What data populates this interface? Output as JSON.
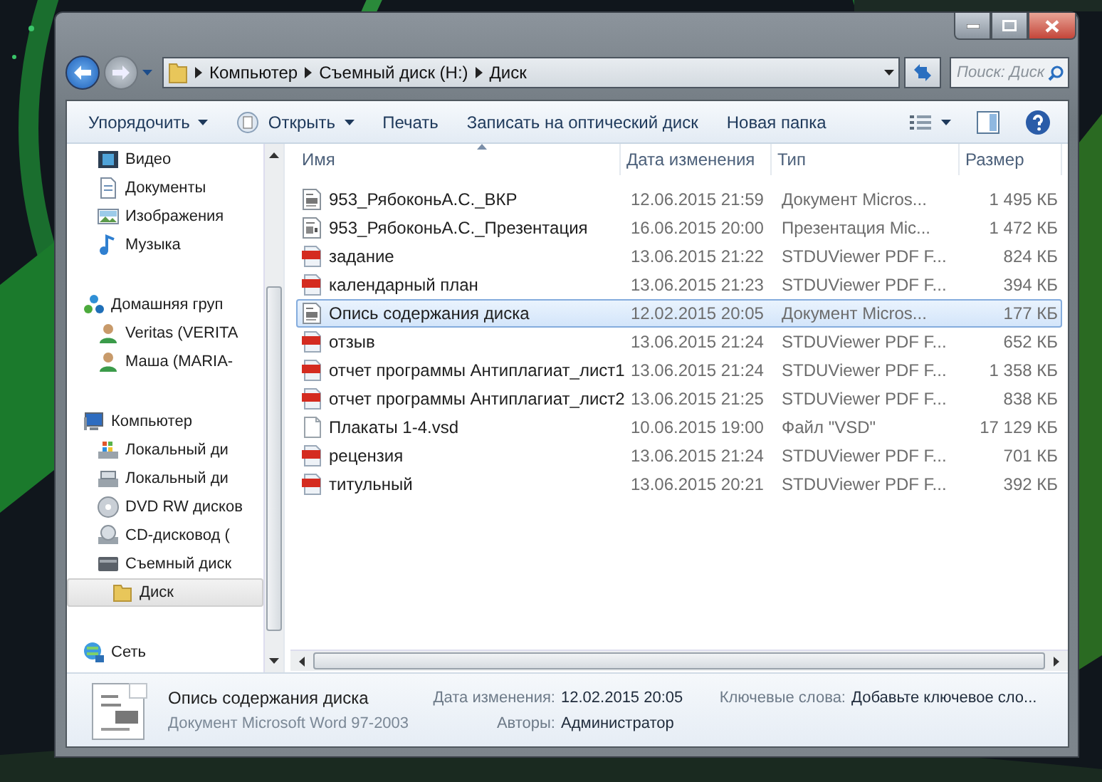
{
  "address": {
    "segments": [
      "Компьютер",
      "Съемный диск (H:)",
      "Диск"
    ],
    "search": {
      "placeholder": "Поиск: Диск"
    }
  },
  "toolbar": [
    {
      "label": "Упорядочить",
      "kind": "menu"
    },
    {
      "label": "Открыть",
      "kind": "open"
    },
    {
      "label": "Печать",
      "kind": "plain"
    },
    {
      "label": "Записать на оптический диск",
      "kind": "plain"
    },
    {
      "label": "Новая папка",
      "kind": "plain"
    }
  ],
  "nav": [
    {
      "children": [
        {
          "label": "Видео",
          "kind": "video",
          "selected": false
        },
        {
          "label": "Документы",
          "kind": "documents",
          "selected": false
        },
        {
          "label": "Изображения",
          "kind": "pictures",
          "selected": false
        },
        {
          "label": "Музыка",
          "kind": "music",
          "selected": false
        }
      ]
    },
    {
      "label": "Домашняя груп",
      "kind": "homegroup",
      "selected": false,
      "children": [
        {
          "label": "Veritas (VERITA",
          "kind": "user",
          "selected": false
        },
        {
          "label": "Маша (MARIA-",
          "kind": "user",
          "selected": false
        }
      ]
    },
    {
      "label": "Компьютер",
      "kind": "computer",
      "selected": false,
      "children": [
        {
          "label": "Локальный ди",
          "kind": "windrive",
          "selected": false
        },
        {
          "label": "Локальный ди",
          "kind": "drive",
          "selected": false
        },
        {
          "label": "DVD RW дисков",
          "kind": "dvd",
          "selected": false
        },
        {
          "label": "CD-дисковод (",
          "kind": "cd",
          "selected": false
        },
        {
          "label": "Съемный диск",
          "kind": "usb",
          "selected": false,
          "children": [
            {
              "label": "Диск",
              "kind": "folder",
              "selected": true
            }
          ]
        }
      ]
    },
    {
      "label": "Сеть",
      "kind": "network",
      "selected": false
    }
  ],
  "columns": [
    "Имя",
    "Дата изменения",
    "Тип",
    "Размер"
  ],
  "files": [
    {
      "name": "953_РябоконьА.С._ВКР",
      "modified": "12.06.2015 21:59",
      "type": "Документ Micros...",
      "size": "1 495 КБ",
      "kind": "word",
      "selected": false
    },
    {
      "name": "953_РябоконьА.С._Презентация",
      "modified": "16.06.2015 20:00",
      "type": "Презентация Mic...",
      "size": "1 472 КБ",
      "kind": "slides",
      "selected": false
    },
    {
      "name": "задание",
      "modified": "13.06.2015 21:22",
      "type": "STDUViewer PDF F...",
      "size": "824 КБ",
      "kind": "pdf",
      "selected": false
    },
    {
      "name": "календарный план",
      "modified": "13.06.2015 21:23",
      "type": "STDUViewer PDF F...",
      "size": "394 КБ",
      "kind": "pdf",
      "selected": false
    },
    {
      "name": "Опись содержания диска",
      "modified": "12.02.2015 20:05",
      "type": "Документ Micros...",
      "size": "177 КБ",
      "kind": "word",
      "selected": true
    },
    {
      "name": "отзыв",
      "modified": "13.06.2015 21:24",
      "type": "STDUViewer PDF F...",
      "size": "652 КБ",
      "kind": "pdf",
      "selected": false
    },
    {
      "name": "отчет программы Антиплагиат_лист1",
      "modified": "13.06.2015 21:24",
      "type": "STDUViewer PDF F...",
      "size": "1 358 КБ",
      "kind": "pdf",
      "selected": false
    },
    {
      "name": "отчет программы Антиплагиат_лист2",
      "modified": "13.06.2015 21:25",
      "type": "STDUViewer PDF F...",
      "size": "838 КБ",
      "kind": "pdf",
      "selected": false
    },
    {
      "name": "Плакаты 1-4.vsd",
      "modified": "10.06.2015 19:00",
      "type": "Файл \"VSD\"",
      "size": "17 129 КБ",
      "kind": "blank",
      "selected": false
    },
    {
      "name": "рецензия",
      "modified": "13.06.2015 21:24",
      "type": "STDUViewer PDF F...",
      "size": "701 КБ",
      "kind": "pdf",
      "selected": false
    },
    {
      "name": "титульный",
      "modified": "13.06.2015 20:21",
      "type": "STDUViewer PDF F...",
      "size": "392 КБ",
      "kind": "pdf",
      "selected": false
    }
  ],
  "details": {
    "name": "Опись содержания диска",
    "type": "Документ Microsoft Word 97-2003",
    "fields": [
      {
        "label": "Дата изменения:",
        "value": "12.02.2015 20:05"
      },
      {
        "label": "Авторы:",
        "value": "Администратор"
      },
      {
        "label": "Ключевые слова:",
        "value": "Добавьте ключевое сло..."
      }
    ]
  }
}
